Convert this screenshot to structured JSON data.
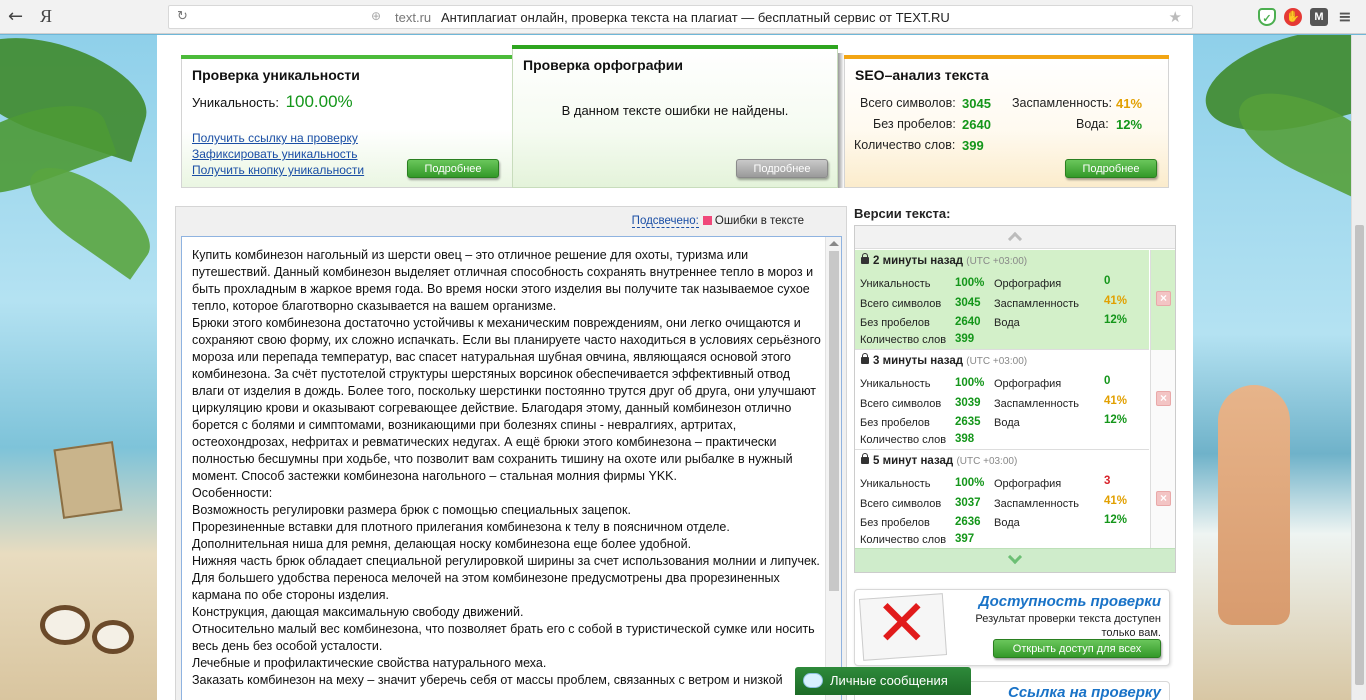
{
  "browser": {
    "back_icon": "←",
    "yandex_logo": "Я",
    "domain": "text.ru",
    "page_title": "Антиплагиат онлайн, проверка текста на плагиат — бесплатный сервис от TEXT.RU"
  },
  "uniqueness_card": {
    "title": "Проверка уникальности",
    "label": "Уникальность:",
    "value": "100.00%",
    "links": [
      "Получить ссылку на проверку",
      "Зафиксировать уникальность",
      "Получить кнопку уникальности"
    ],
    "button": "Подробнее"
  },
  "spelling_card": {
    "title": "Проверка орфографии",
    "message": "В данном тексте ошибки не найдены.",
    "button": "Подробнее"
  },
  "seo_card": {
    "title": "SEO–анализ текста",
    "total_chars_label": "Всего символов:",
    "total_chars": "3045",
    "spam_label": "Заспамленность:",
    "spam": "41%",
    "no_spaces_label": "Без пробелов:",
    "no_spaces": "2640",
    "water_label": "Вода:",
    "water": "12%",
    "words_label": "Количество слов:",
    "words": "399",
    "button": "Подробнее"
  },
  "text_panel": {
    "checked_label": "Подсвечено:",
    "errors_label": "Ошибки в тексте",
    "paragraphs": [
      "Купить комбинезон нагольный из шерсти овец – это отличное решение для охоты, туризма или путешествий. Данный комбинезон выделяет отличная способность сохранять внутреннее тепло в мороз и быть прохладным в жаркое время года. Во время носки этого изделия вы получите так называемое сухое тепло, которое благотворно сказывается на вашем организме.",
      "Брюки этого комбинезона достаточно устойчивы к механическим повреждениям, они легко очищаются и сохраняют свою форму, их сложно испачкать. Если вы планируете часто находиться в условиях серьёзного мороза или перепада температур, вас спасет натуральная шубная овчина, являющаяся основой этого комбинезона. За счёт пустотелой структуры шерстяных ворсинок обеспечивается эффективный отвод влаги от изделия в дождь. Более того, поскольку шерстинки постоянно трутся друг об друга, они улучшают циркуляцию крови и оказывают согревающее действие. Благодаря этому, данный комбинезон отлично борется с болями и симптомами, возникающими при болезнях спины - невралгиях, артритах, остеохондрозах, нефритах и ревматических недугах. А ещё брюки этого комбинезона – практически полностью бесшумны при ходьбе, что позволит вам сохранить тишину на охоте или рыбалке в нужный момент. Способ застежки комбинезона нагольного – стальная молния фирмы YKK.",
      "Особенности:",
      "Возможность регулировки размера брюк с помощью специальных зацепок.",
      "Прорезиненные вставки для плотного прилегания комбинезона к телу в поясничном отделе.",
      "Дополнительная ниша для ремня, делающая носку комбинезона еще более удобной.",
      "Нижняя часть брюк обладает специальной регулировкой ширины за счет использования молнии и липучек.",
      "Для большего удобства переноса мелочей на этом комбинезоне предусмотрены два прорезиненных кармана по обе стороны изделия.",
      "Конструкция, дающая максимальную свободу движений.",
      "Относительно малый вес комбинезона, что позволяет брать его с собой в туристической сумке или носить весь день без особой усталости.",
      "Лечебные и профилактические свойства натурального меха.",
      "Заказать комбинезон на меху – значит уберечь себя от массы проблем, связанных с ветром и низкой"
    ]
  },
  "versions": {
    "title": "Версии текста:",
    "items": [
      {
        "time": "2 минуты назад",
        "utc": "(UTC +03:00)",
        "uniq_label": "Уникальность",
        "uniq": "100%",
        "spell_label": "Орфография",
        "spell": "0",
        "chars_label": "Всего символов",
        "chars": "3045",
        "spam_label": "Заспамленность",
        "spam": "41%",
        "nosp_label": "Без пробелов",
        "nosp": "2640",
        "water_label": "Вода",
        "water": "12%",
        "words_label": "Количество слов",
        "words": "399"
      },
      {
        "time": "3 минуты назад",
        "utc": "(UTC +03:00)",
        "uniq_label": "Уникальность",
        "uniq": "100%",
        "spell_label": "Орфография",
        "spell": "0",
        "chars_label": "Всего символов",
        "chars": "3039",
        "spam_label": "Заспамленность",
        "spam": "41%",
        "nosp_label": "Без пробелов",
        "nosp": "2635",
        "water_label": "Вода",
        "water": "12%",
        "words_label": "Количество слов",
        "words": "398"
      },
      {
        "time": "5 минут назад",
        "utc": "(UTC +03:00)",
        "uniq_label": "Уникальность",
        "uniq": "100%",
        "spell_label": "Орфография",
        "spell": "3",
        "chars_label": "Всего символов",
        "chars": "3037",
        "spam_label": "Заспамленность",
        "spam": "41%",
        "nosp_label": "Без пробелов",
        "nosp": "2636",
        "water_label": "Вода",
        "water": "12%",
        "words_label": "Количество слов",
        "words": "397"
      }
    ]
  },
  "access_promo": {
    "title": "Доступность проверки",
    "text": "Результат проверки текста доступен только вам.",
    "button": "Открыть доступ для всех"
  },
  "link_promo": {
    "title": "Ссылка на проверку"
  },
  "messages": {
    "label": "Личные сообщения"
  }
}
